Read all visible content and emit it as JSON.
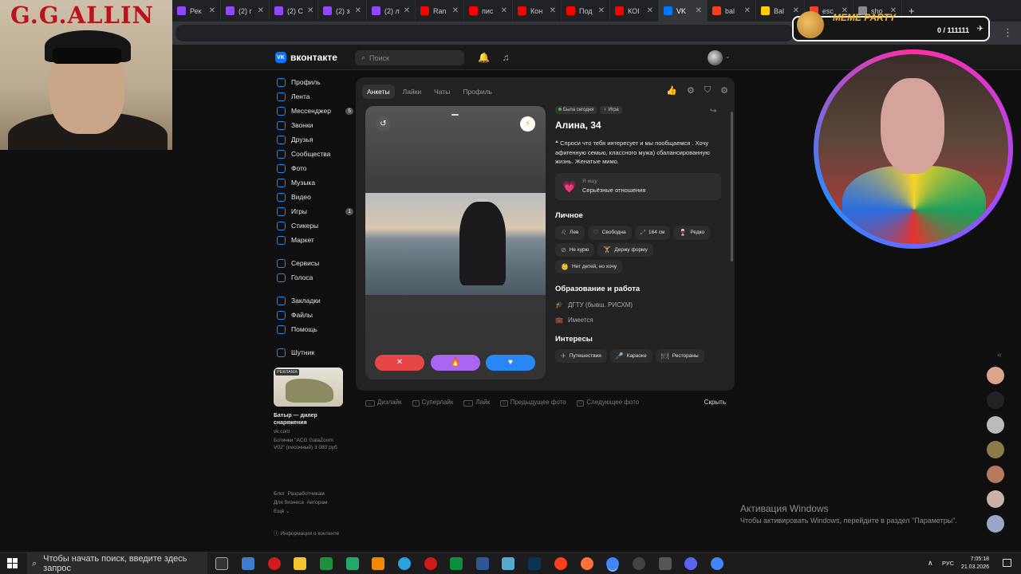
{
  "browser": {
    "tabs": [
      {
        "label": "Рек",
        "color": "#9146ff"
      },
      {
        "label": "(2) г",
        "color": "#9146ff"
      },
      {
        "label": "(2) С",
        "color": "#9146ff"
      },
      {
        "label": "(2) з",
        "color": "#9146ff"
      },
      {
        "label": "(2) л",
        "color": "#9146ff"
      },
      {
        "label": "Ran",
        "color": "#ff0000"
      },
      {
        "label": "пис",
        "color": "#ff0000"
      },
      {
        "label": "Кон",
        "color": "#ff0000"
      },
      {
        "label": "Под",
        "color": "#ff0000"
      },
      {
        "label": "КОІ",
        "color": "#ff0000"
      },
      {
        "label": "VK",
        "color": "#0077ff"
      },
      {
        "label": "bal",
        "color": "#fc3f1d"
      },
      {
        "label": "Bal",
        "color": "#ffcc00"
      },
      {
        "label": "esc",
        "color": "#fc3f1d"
      },
      {
        "label": "sho",
        "color": "#8a8a8a"
      }
    ],
    "active_tab": 10,
    "add_tab": "+"
  },
  "overlay": {
    "left_title": "G.G.ALLIN",
    "meme_party": "MEME PARTY",
    "meme_count": "0 / 111111"
  },
  "vk": {
    "logo_text": "вконтакте",
    "logo_mark": "VK",
    "search_placeholder": "Поиск",
    "nav": [
      {
        "label": "Профиль",
        "badge": ""
      },
      {
        "label": "Лента",
        "badge": ""
      },
      {
        "label": "Мессенджер",
        "badge": "5"
      },
      {
        "label": "Звонки",
        "badge": ""
      },
      {
        "label": "Друзья",
        "badge": ""
      },
      {
        "label": "Сообщества",
        "badge": ""
      },
      {
        "label": "Фото",
        "badge": ""
      },
      {
        "label": "Музыка",
        "badge": ""
      },
      {
        "label": "Видео",
        "badge": ""
      },
      {
        "label": "Игры",
        "badge": "1"
      },
      {
        "label": "Стикеры",
        "badge": ""
      },
      {
        "label": "Маркет",
        "badge": ""
      }
    ],
    "nav2": [
      {
        "label": "Сервисы"
      },
      {
        "label": "Голоса"
      }
    ],
    "nav3": [
      {
        "label": "Закладки"
      },
      {
        "label": "Файлы"
      },
      {
        "label": "Помощь"
      }
    ],
    "nav4": [
      {
        "label": "Шутник"
      }
    ],
    "ad": {
      "label": "РЕКЛАМА",
      "title": "Батыр — дилер снаряжения",
      "domain": "vk.com",
      "desc": "Ботинки \"ACG GalaZoom V02\" (песочный) 3 080 руб"
    },
    "footer": {
      "row1a": "Блог",
      "row1b": "Разработчикам",
      "row2a": "Для бизнеса",
      "row2b": "Авторам",
      "row3": "Ещё ⌄",
      "info": "Информация о контенте"
    }
  },
  "dating": {
    "tabs": [
      "Анкеты",
      "Лайки",
      "Чаты",
      "Профиль"
    ],
    "active_tab": 0,
    "status_online": "Была сегодня",
    "status_game": "Игра",
    "name": "Алина, 34",
    "bio": "Спроси что тебя интересует и мы пообщаемся . Хочу афигенную семью, классного мужа) сбалансированную жизнь. Женатые мимо.",
    "seek_label": "Я ищу",
    "seek_value": "Серьёзные отношения",
    "personal_title": "Личное",
    "personal": [
      {
        "icon": "♌",
        "text": "Лев"
      },
      {
        "icon": "♡",
        "text": "Свободна"
      },
      {
        "icon": "⤢",
        "text": "164 см"
      },
      {
        "icon": "🍷",
        "text": "Редко"
      },
      {
        "icon": "⊘",
        "text": "Не курю"
      },
      {
        "icon": "🏋",
        "text": "Держу форму"
      },
      {
        "icon": "👶",
        "text": "Нет детей, но хочу"
      }
    ],
    "edu_title": "Образование и работа",
    "edu": [
      {
        "icon": "🎓",
        "text": "ДГТУ (бывш. РИСХМ)"
      },
      {
        "icon": "💼",
        "text": "Имеется"
      }
    ],
    "interests_title": "Интересы",
    "interests": [
      {
        "icon": "✈",
        "text": "Путешествия"
      },
      {
        "icon": "🎤",
        "text": "Караоке"
      },
      {
        "icon": "🍽",
        "text": "Рестораны"
      }
    ],
    "buttons": {
      "dislike": "✕",
      "super": "🔥",
      "like": "♥"
    },
    "controls": [
      {
        "key": "←",
        "label": "Дизлайк"
      },
      {
        "key": "↑",
        "label": "Суперлайк"
      },
      {
        "key": "→",
        "label": "Лайк"
      },
      {
        "key": "",
        "label": "Предыдущее фото"
      },
      {
        "key": "",
        "label": "Следующее фото"
      }
    ],
    "hide": "Скрыть"
  },
  "windows": {
    "activation_title": "Активация Windows",
    "activation_text": "Чтобы активировать Windows, перейдите в раздел \"Параметры\".",
    "search_placeholder": "Чтобы начать поиск, введите здесь запрос",
    "lang": "РУС",
    "time": "7:05:18",
    "date": "21.03.2026",
    "tray_chevron": "∧"
  }
}
